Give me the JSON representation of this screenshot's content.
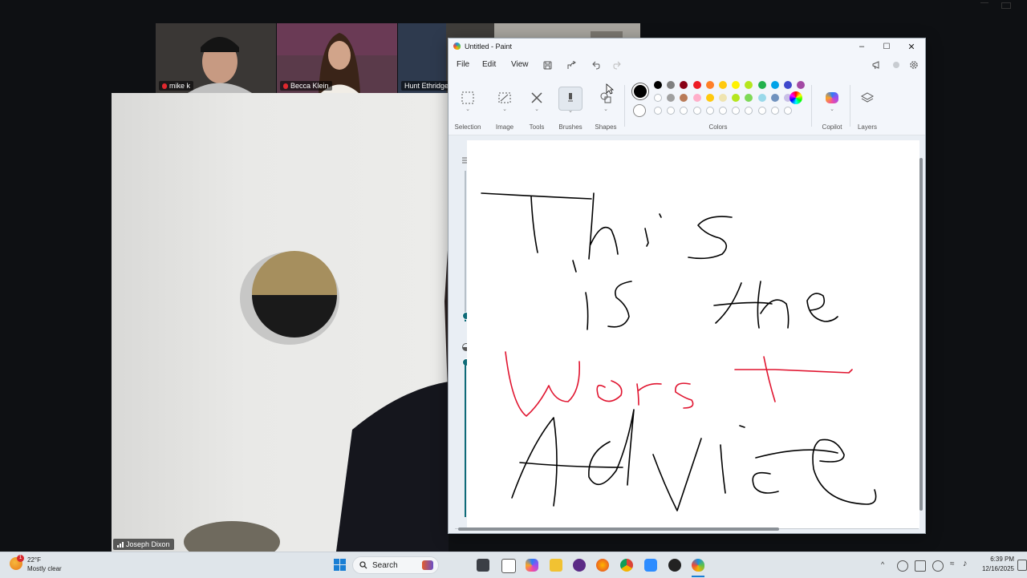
{
  "call": {
    "participants": [
      {
        "name": "mike k",
        "muted": true
      },
      {
        "name": "Becca Klein",
        "muted": true
      },
      {
        "name": "Hunt Ethridge",
        "muted": false
      }
    ],
    "speaker": {
      "name": "Joseph Dixon"
    }
  },
  "paint": {
    "title": "Untitled - Paint",
    "window_buttons": {
      "minimize": "–",
      "maximize": "☐",
      "close": "✕"
    },
    "menu": [
      "File",
      "Edit",
      "View"
    ],
    "ribbon_groups": [
      "Selection",
      "Image",
      "Tools",
      "Brushes",
      "Shapes",
      "Colors",
      "Copilot",
      "Layers"
    ],
    "colors": {
      "current": "#000000",
      "row1": [
        "#000000",
        "#7f7f7f",
        "#880015",
        "#ed1c24",
        "#ff7f27",
        "#ffc90e",
        "#fff200",
        "#b5e61d",
        "#22b14c",
        "#00a2e8",
        "#3f48cc",
        "#a349a4"
      ],
      "row2": [
        "",
        "#a0a0a0",
        "#b97a57",
        "#ffaec9",
        "#ffc90e",
        "#efe4b0",
        "#b5e61d",
        "#7ed957",
        "#99d9ea",
        "#7092be",
        "#c8bfe7"
      ]
    },
    "drawing": {
      "lines": [
        {
          "text": "This",
          "color": "#000000"
        },
        {
          "text": "is the",
          "color": "#000000"
        },
        {
          "text": "Worst",
          "color": "#e0142f"
        },
        {
          "text": "Advice",
          "color": "#000000"
        }
      ]
    }
  },
  "taskbar": {
    "weather": {
      "temp": "22°F",
      "condition": "Mostly clear",
      "badge": "1"
    },
    "search_label": "Search",
    "time": "6:39 PM",
    "date": "12/16/2025"
  }
}
